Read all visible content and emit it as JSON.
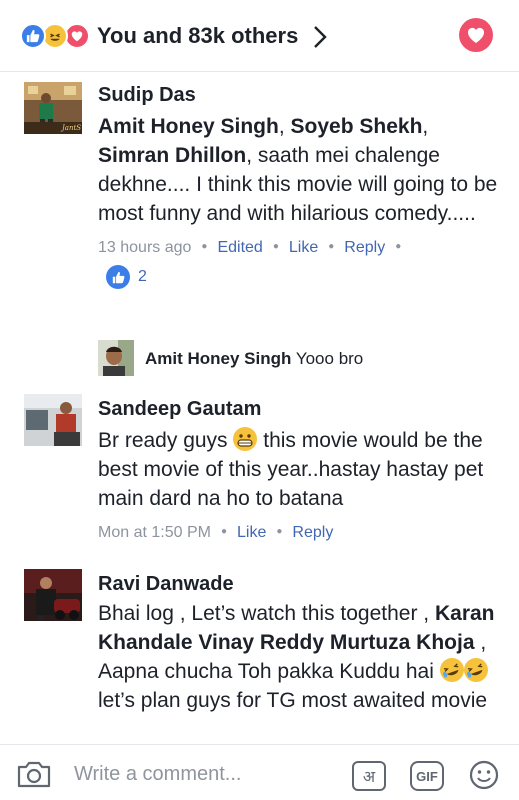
{
  "header": {
    "title": "You and 83k others",
    "reaction_icons": [
      "like-icon",
      "haha-icon",
      "love-icon"
    ],
    "colors": {
      "like": "#3b7ee8",
      "haha": "#f7c23b",
      "love": "#ef4f6a",
      "link": "#4267b2"
    }
  },
  "comments": [
    {
      "author": "Sudip Das",
      "mentions": [
        "Amit Honey Singh",
        "Soyeb Shekh",
        "Simran Dhillon"
      ],
      "sep1": ", ",
      "sep2": ", ",
      "text": ", saath mei chalenge dekhne.... I think this movie will going to be most funny and with hilarious comedy.....",
      "time": "13 hours ago",
      "actions": [
        "Edited",
        "Like",
        "Reply"
      ],
      "like_count": "2",
      "reply": {
        "author": "Amit Honey Singh",
        "text": " Yooo bro"
      }
    },
    {
      "author": "Sandeep Gautam",
      "text_before_emoji": "Br ready guys ",
      "text_after_emoji": " this movie would be the best movie of this year..hastay hastay pet main dard na ho to batana",
      "time": "Mon at 1:50 PM",
      "actions": [
        "Like",
        "Reply"
      ]
    },
    {
      "author": "Ravi Danwade",
      "text_start": "Bhai log , Let’s watch this together ,",
      "mentions": "Karan Khandale Vinay Reddy Murtuza Khoja",
      "text_middle": " , Aapna chucha Toh pakka Kuddu hai ",
      "text_end": " let’s plan guys for TG most awaited movie"
    }
  ],
  "composer": {
    "placeholder": "Write a comment...",
    "hindi_key": "अ",
    "gif_label": "GIF"
  }
}
